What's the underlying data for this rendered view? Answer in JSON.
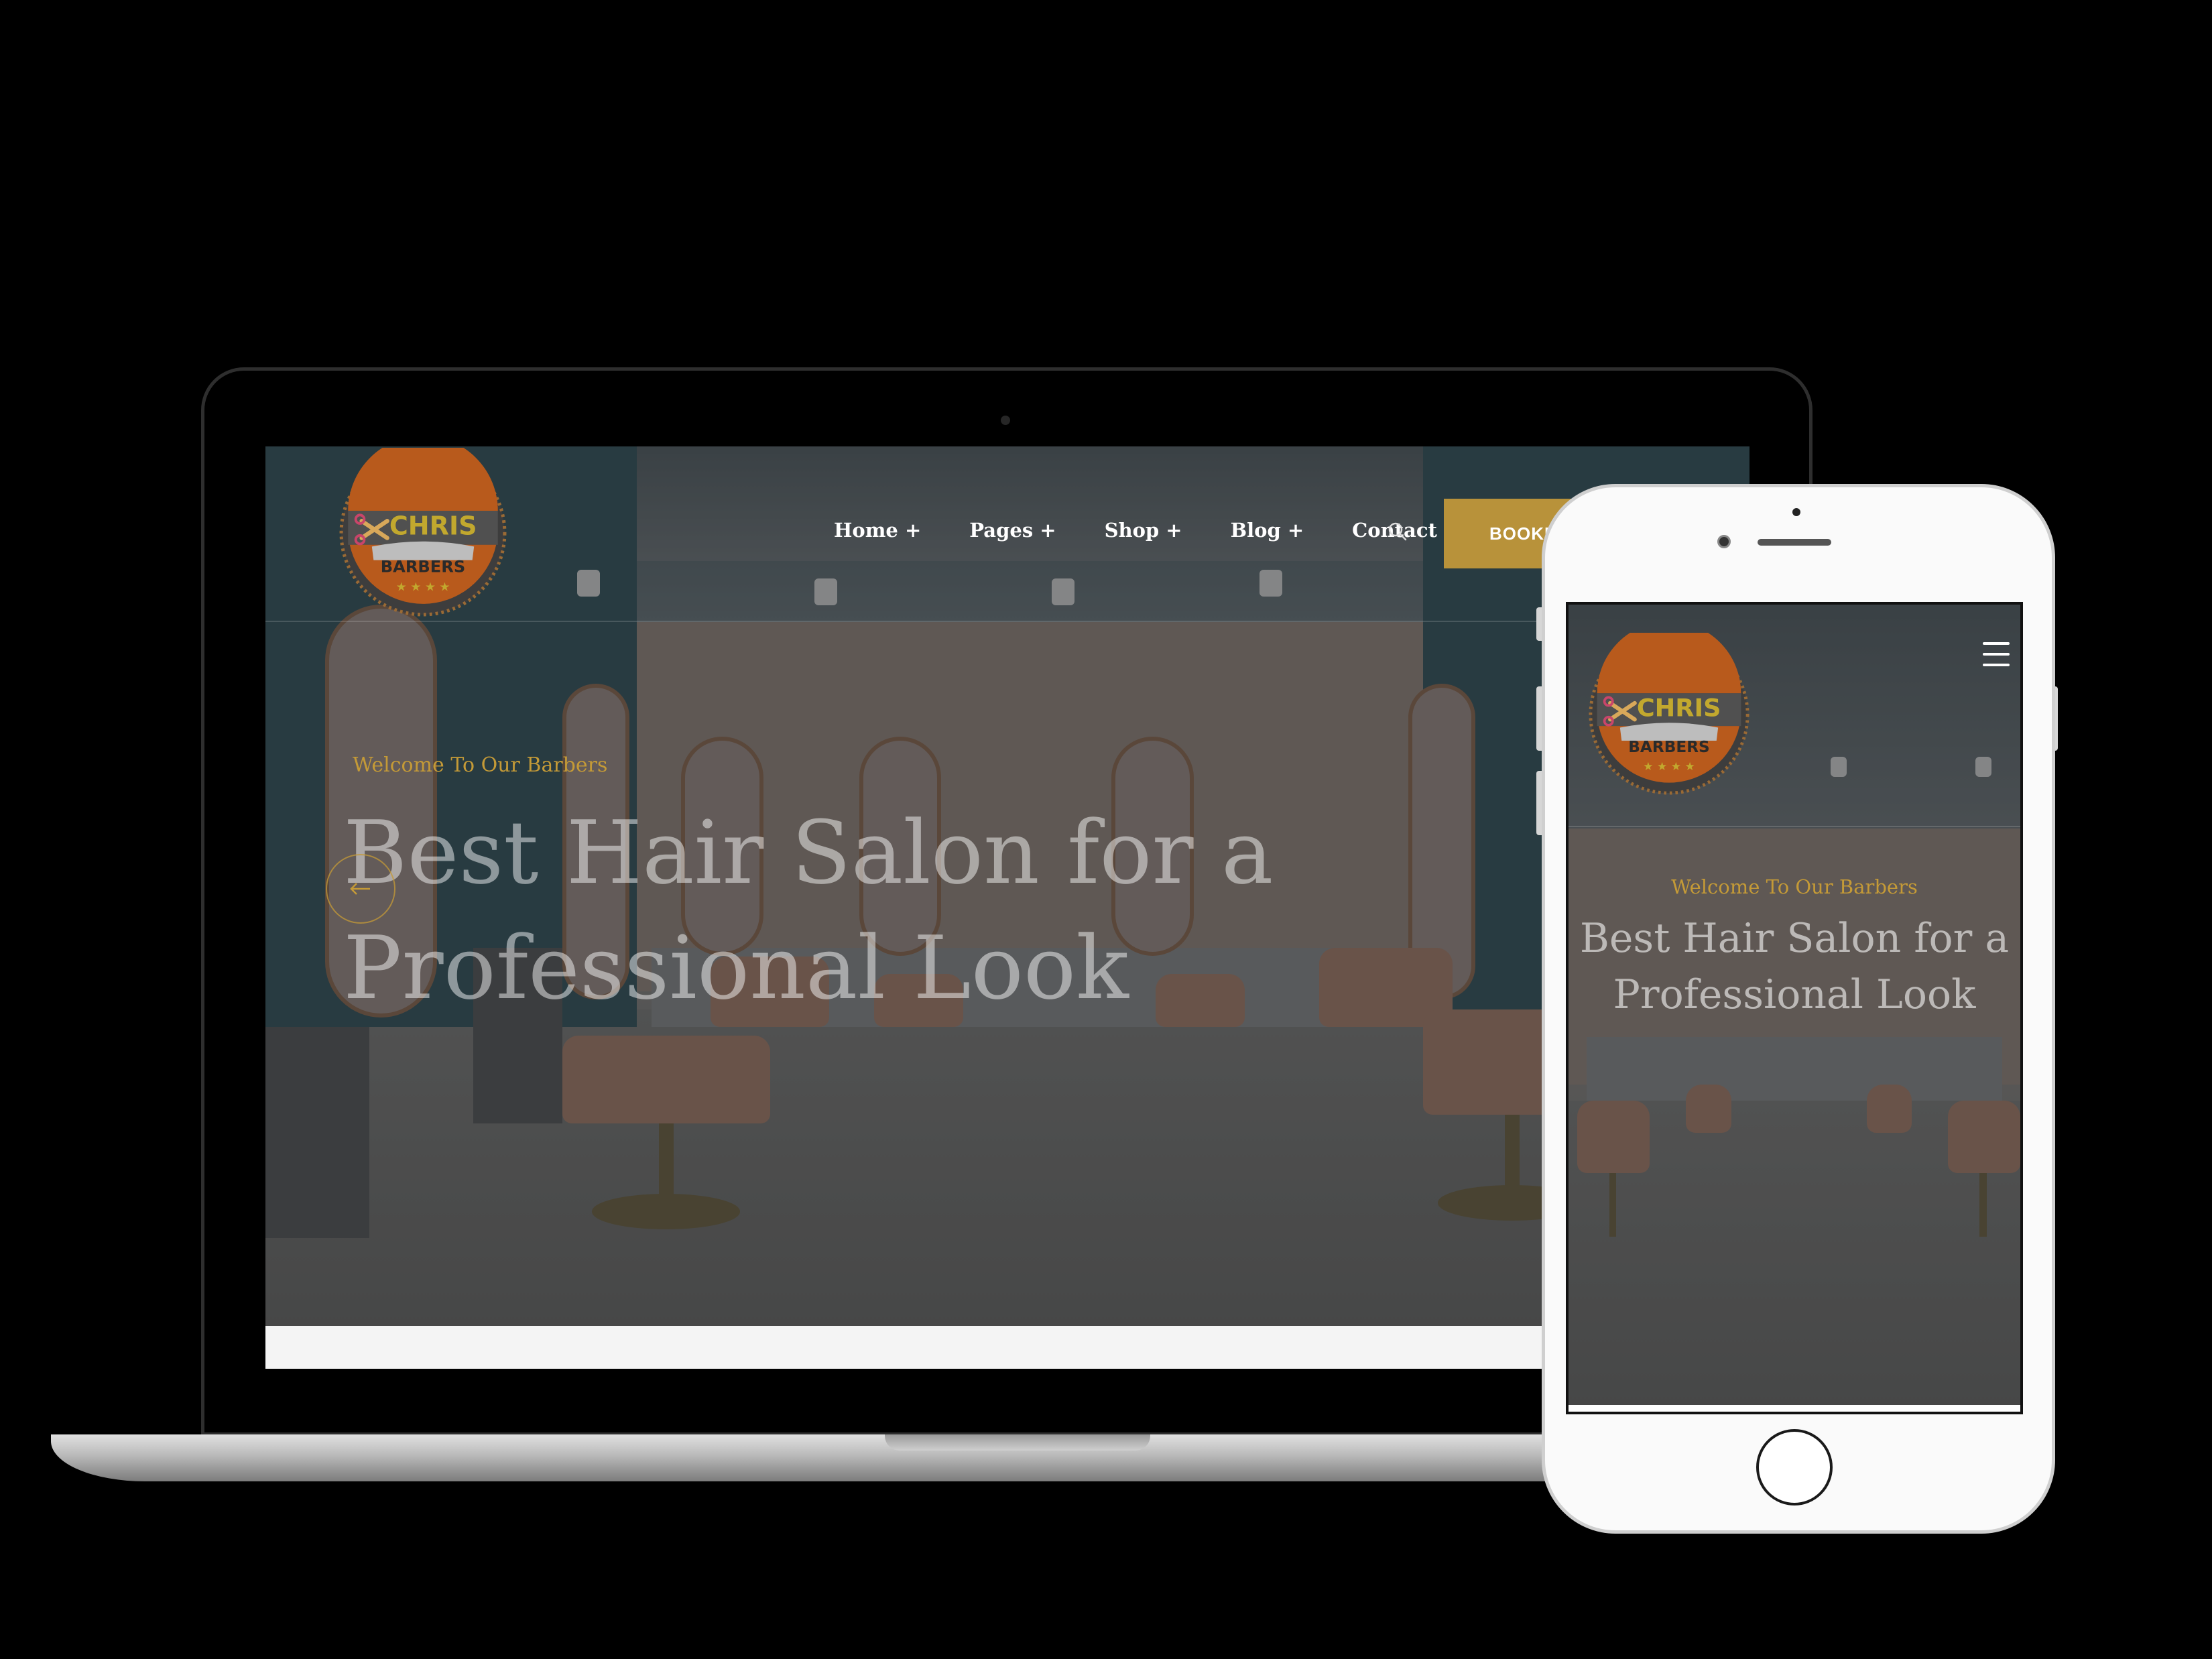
{
  "brand": {
    "name_top": "CHRIS",
    "name_bottom": "BARBERS",
    "colors": {
      "orange": "#E46C1D",
      "gold": "#C49A37",
      "button_gold": "#B8923A",
      "logo_text_yellow": "#F2D23C"
    }
  },
  "desktop": {
    "nav": [
      {
        "label": "Home +",
        "icon": "plus-icon"
      },
      {
        "label": "Pages +",
        "icon": "plus-icon"
      },
      {
        "label": "Shop +",
        "icon": "plus-icon"
      },
      {
        "label": "Blog +",
        "icon": "plus-icon"
      },
      {
        "label": "Contact"
      }
    ],
    "search_icon": "search-icon",
    "booking_label": "BOOKI",
    "hero": {
      "welcome": "Welcome To Our Barbers",
      "title": "Best Hair Salon for a Professional Look",
      "prev_icon": "arrow-left-icon"
    }
  },
  "mobile": {
    "menu_icon": "hamburger-menu-icon",
    "hero": {
      "welcome": "Welcome To Our Barbers",
      "title": "Best Hair Salon for a Professional Look"
    }
  }
}
